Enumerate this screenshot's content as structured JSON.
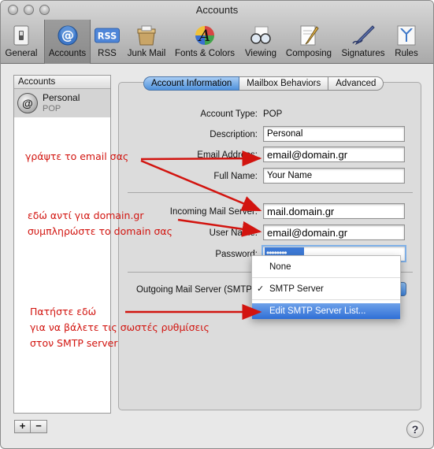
{
  "window": {
    "title": "Accounts"
  },
  "toolbar": {
    "items": [
      {
        "label": "General",
        "icon": "general-switch-icon"
      },
      {
        "label": "Accounts",
        "icon": "at-sign-icon",
        "active": true
      },
      {
        "label": "RSS",
        "icon": "rss-icon"
      },
      {
        "label": "Junk Mail",
        "icon": "junk-mail-icon"
      },
      {
        "label": "Fonts & Colors",
        "icon": "fonts-colors-icon"
      },
      {
        "label": "Viewing",
        "icon": "glasses-icon"
      },
      {
        "label": "Composing",
        "icon": "composing-pencil-icon"
      },
      {
        "label": "Signatures",
        "icon": "signature-pen-icon"
      },
      {
        "label": "Rules",
        "icon": "rules-icon"
      }
    ]
  },
  "sidebar": {
    "header": "Accounts",
    "accounts": [
      {
        "name": "Personal",
        "type": "POP",
        "avatar": "@"
      }
    ],
    "add_label": "+",
    "remove_label": "−"
  },
  "tabs": [
    {
      "label": "Account Information",
      "active": true
    },
    {
      "label": "Mailbox Behaviors"
    },
    {
      "label": "Advanced"
    }
  ],
  "form": {
    "account_type_label": "Account Type:",
    "account_type_value": "POP",
    "description_label": "Description:",
    "description_value": "Personal",
    "email_label": "Email Address:",
    "email_value": "email@domain.gr",
    "fullname_label": "Full Name:",
    "fullname_value": "Your Name",
    "incoming_label": "Incoming Mail Server:",
    "incoming_value": "mail.domain.gr",
    "username_label": "User Name:",
    "username_value": "email@domain.gr",
    "password_label": "Password:",
    "password_mask": "••••••••",
    "smtp_label": "Outgoing Mail Server (SMTP):"
  },
  "smtp_menu": {
    "items": [
      {
        "label": "None"
      },
      {
        "label": "SMTP Server",
        "checked": true
      },
      {
        "label": "Edit SMTP Server List...",
        "highlighted": true
      }
    ],
    "check_mark": "✓"
  },
  "annotations": {
    "email_note": "γράψτε το email σας",
    "domain_note_1": "εδώ αντί για domain.gr",
    "domain_note_2": "συμπληρώστε το domain σας",
    "smtp_note_1": "Πατήστε εδώ",
    "smtp_note_2": "για να βάλετε τις σωστές ρυθμίσεις",
    "smtp_note_3": "στον SMTP server",
    "color": "#d2140f"
  },
  "help_label": "?"
}
